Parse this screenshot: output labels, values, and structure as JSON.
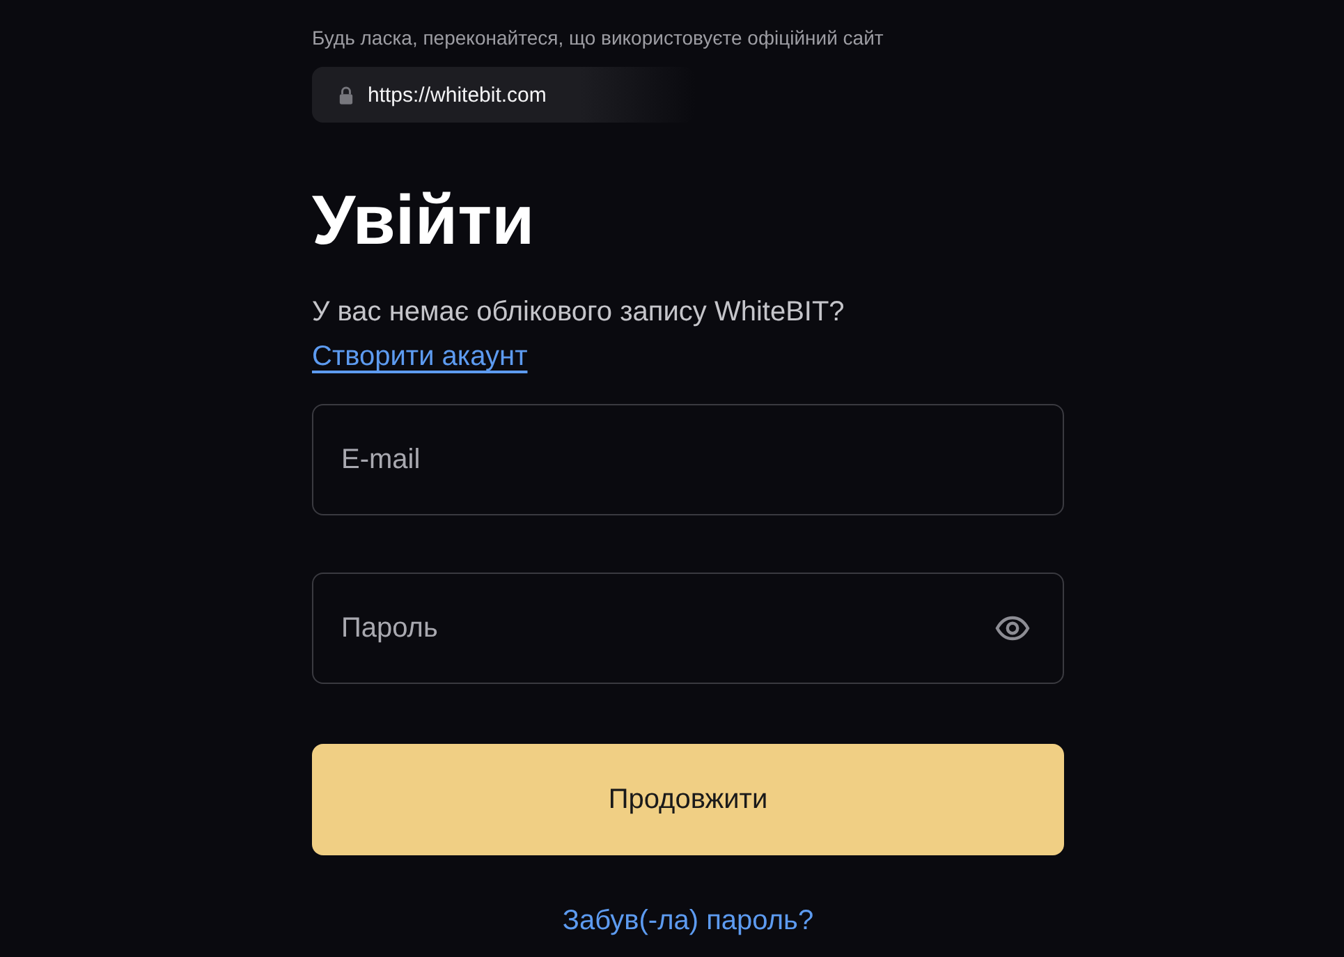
{
  "notice": "Будь ласка, переконайтеся, що використовуєте офіційний сайт",
  "url": "https://whitebit.com",
  "title": "Увійти",
  "prompt": "У вас немає облікового запису WhiteBIT?",
  "signup_link": "Створити акаунт",
  "fields": [
    {
      "kind": "text",
      "placeholder": "E-mail"
    },
    {
      "kind": "password",
      "placeholder": "Пароль"
    }
  ],
  "submit": "Продовжити",
  "forgot_link": "Забув(-ла) пароль?"
}
